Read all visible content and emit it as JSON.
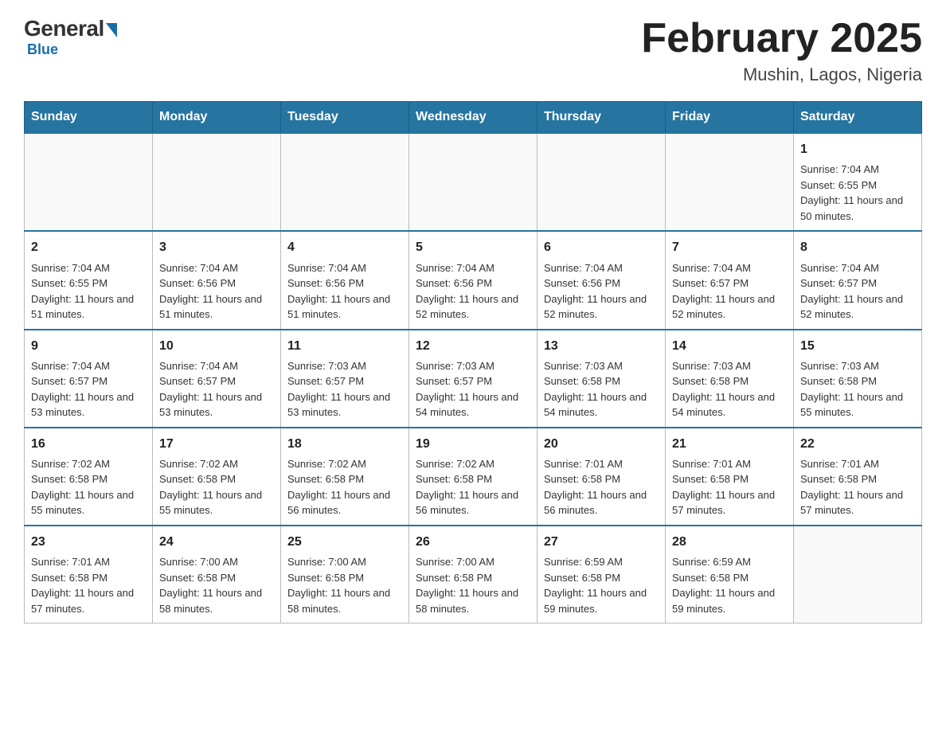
{
  "header": {
    "logo_general": "General",
    "logo_blue": "Blue",
    "month_title": "February 2025",
    "location": "Mushin, Lagos, Nigeria"
  },
  "weekdays": [
    "Sunday",
    "Monday",
    "Tuesday",
    "Wednesday",
    "Thursday",
    "Friday",
    "Saturday"
  ],
  "weeks": [
    [
      {
        "day": "",
        "sunrise": "",
        "sunset": "",
        "daylight": ""
      },
      {
        "day": "",
        "sunrise": "",
        "sunset": "",
        "daylight": ""
      },
      {
        "day": "",
        "sunrise": "",
        "sunset": "",
        "daylight": ""
      },
      {
        "day": "",
        "sunrise": "",
        "sunset": "",
        "daylight": ""
      },
      {
        "day": "",
        "sunrise": "",
        "sunset": "",
        "daylight": ""
      },
      {
        "day": "",
        "sunrise": "",
        "sunset": "",
        "daylight": ""
      },
      {
        "day": "1",
        "sunrise": "Sunrise: 7:04 AM",
        "sunset": "Sunset: 6:55 PM",
        "daylight": "Daylight: 11 hours and 50 minutes."
      }
    ],
    [
      {
        "day": "2",
        "sunrise": "Sunrise: 7:04 AM",
        "sunset": "Sunset: 6:55 PM",
        "daylight": "Daylight: 11 hours and 51 minutes."
      },
      {
        "day": "3",
        "sunrise": "Sunrise: 7:04 AM",
        "sunset": "Sunset: 6:56 PM",
        "daylight": "Daylight: 11 hours and 51 minutes."
      },
      {
        "day": "4",
        "sunrise": "Sunrise: 7:04 AM",
        "sunset": "Sunset: 6:56 PM",
        "daylight": "Daylight: 11 hours and 51 minutes."
      },
      {
        "day": "5",
        "sunrise": "Sunrise: 7:04 AM",
        "sunset": "Sunset: 6:56 PM",
        "daylight": "Daylight: 11 hours and 52 minutes."
      },
      {
        "day": "6",
        "sunrise": "Sunrise: 7:04 AM",
        "sunset": "Sunset: 6:56 PM",
        "daylight": "Daylight: 11 hours and 52 minutes."
      },
      {
        "day": "7",
        "sunrise": "Sunrise: 7:04 AM",
        "sunset": "Sunset: 6:57 PM",
        "daylight": "Daylight: 11 hours and 52 minutes."
      },
      {
        "day": "8",
        "sunrise": "Sunrise: 7:04 AM",
        "sunset": "Sunset: 6:57 PM",
        "daylight": "Daylight: 11 hours and 52 minutes."
      }
    ],
    [
      {
        "day": "9",
        "sunrise": "Sunrise: 7:04 AM",
        "sunset": "Sunset: 6:57 PM",
        "daylight": "Daylight: 11 hours and 53 minutes."
      },
      {
        "day": "10",
        "sunrise": "Sunrise: 7:04 AM",
        "sunset": "Sunset: 6:57 PM",
        "daylight": "Daylight: 11 hours and 53 minutes."
      },
      {
        "day": "11",
        "sunrise": "Sunrise: 7:03 AM",
        "sunset": "Sunset: 6:57 PM",
        "daylight": "Daylight: 11 hours and 53 minutes."
      },
      {
        "day": "12",
        "sunrise": "Sunrise: 7:03 AM",
        "sunset": "Sunset: 6:57 PM",
        "daylight": "Daylight: 11 hours and 54 minutes."
      },
      {
        "day": "13",
        "sunrise": "Sunrise: 7:03 AM",
        "sunset": "Sunset: 6:58 PM",
        "daylight": "Daylight: 11 hours and 54 minutes."
      },
      {
        "day": "14",
        "sunrise": "Sunrise: 7:03 AM",
        "sunset": "Sunset: 6:58 PM",
        "daylight": "Daylight: 11 hours and 54 minutes."
      },
      {
        "day": "15",
        "sunrise": "Sunrise: 7:03 AM",
        "sunset": "Sunset: 6:58 PM",
        "daylight": "Daylight: 11 hours and 55 minutes."
      }
    ],
    [
      {
        "day": "16",
        "sunrise": "Sunrise: 7:02 AM",
        "sunset": "Sunset: 6:58 PM",
        "daylight": "Daylight: 11 hours and 55 minutes."
      },
      {
        "day": "17",
        "sunrise": "Sunrise: 7:02 AM",
        "sunset": "Sunset: 6:58 PM",
        "daylight": "Daylight: 11 hours and 55 minutes."
      },
      {
        "day": "18",
        "sunrise": "Sunrise: 7:02 AM",
        "sunset": "Sunset: 6:58 PM",
        "daylight": "Daylight: 11 hours and 56 minutes."
      },
      {
        "day": "19",
        "sunrise": "Sunrise: 7:02 AM",
        "sunset": "Sunset: 6:58 PM",
        "daylight": "Daylight: 11 hours and 56 minutes."
      },
      {
        "day": "20",
        "sunrise": "Sunrise: 7:01 AM",
        "sunset": "Sunset: 6:58 PM",
        "daylight": "Daylight: 11 hours and 56 minutes."
      },
      {
        "day": "21",
        "sunrise": "Sunrise: 7:01 AM",
        "sunset": "Sunset: 6:58 PM",
        "daylight": "Daylight: 11 hours and 57 minutes."
      },
      {
        "day": "22",
        "sunrise": "Sunrise: 7:01 AM",
        "sunset": "Sunset: 6:58 PM",
        "daylight": "Daylight: 11 hours and 57 minutes."
      }
    ],
    [
      {
        "day": "23",
        "sunrise": "Sunrise: 7:01 AM",
        "sunset": "Sunset: 6:58 PM",
        "daylight": "Daylight: 11 hours and 57 minutes."
      },
      {
        "day": "24",
        "sunrise": "Sunrise: 7:00 AM",
        "sunset": "Sunset: 6:58 PM",
        "daylight": "Daylight: 11 hours and 58 minutes."
      },
      {
        "day": "25",
        "sunrise": "Sunrise: 7:00 AM",
        "sunset": "Sunset: 6:58 PM",
        "daylight": "Daylight: 11 hours and 58 minutes."
      },
      {
        "day": "26",
        "sunrise": "Sunrise: 7:00 AM",
        "sunset": "Sunset: 6:58 PM",
        "daylight": "Daylight: 11 hours and 58 minutes."
      },
      {
        "day": "27",
        "sunrise": "Sunrise: 6:59 AM",
        "sunset": "Sunset: 6:58 PM",
        "daylight": "Daylight: 11 hours and 59 minutes."
      },
      {
        "day": "28",
        "sunrise": "Sunrise: 6:59 AM",
        "sunset": "Sunset: 6:58 PM",
        "daylight": "Daylight: 11 hours and 59 minutes."
      },
      {
        "day": "",
        "sunrise": "",
        "sunset": "",
        "daylight": ""
      }
    ]
  ]
}
